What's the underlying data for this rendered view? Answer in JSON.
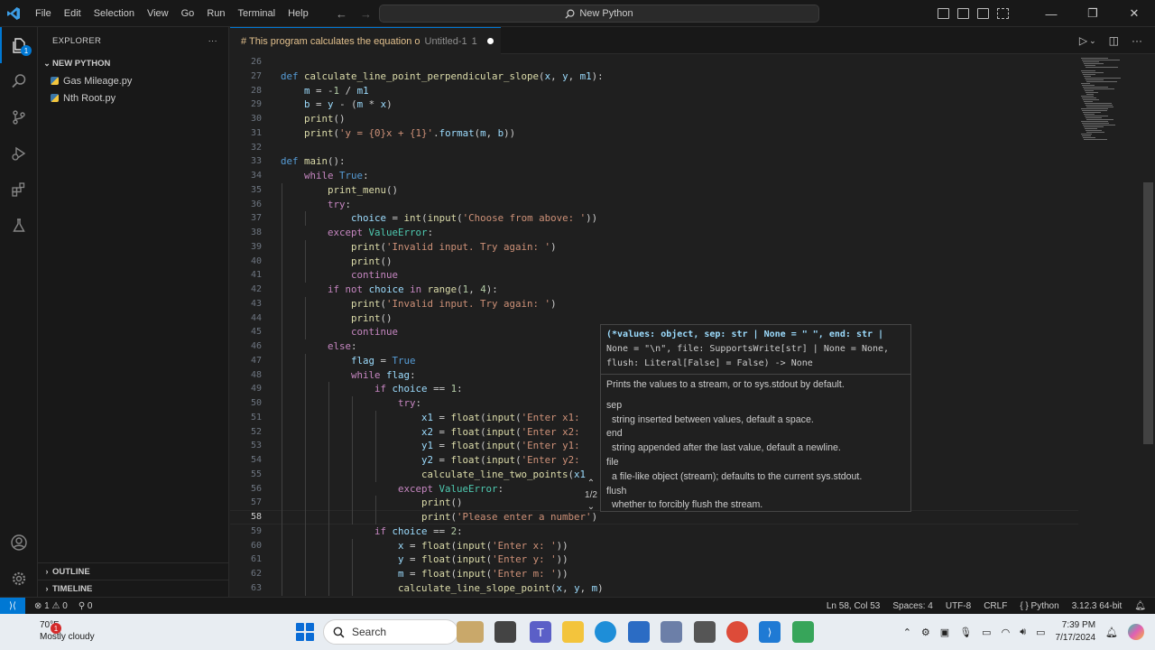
{
  "titlebar": {
    "menu": [
      "File",
      "Edit",
      "Selection",
      "View",
      "Go",
      "Run",
      "Terminal",
      "Help"
    ],
    "search_text": "New Python",
    "back_arrow": "←",
    "forward_arrow": "→"
  },
  "activity": {
    "explorer_badge": "1"
  },
  "sidebar": {
    "header": "EXPLORER",
    "more": "···",
    "folder": "NEW PYTHON",
    "files": [
      "Gas Mileage.py",
      "Nth Root.py"
    ],
    "outline": "OUTLINE",
    "timeline": "TIMELINE"
  },
  "tab": {
    "title": "# This program calculates the equation o",
    "file": "Untitled-1",
    "number": "1"
  },
  "editor": {
    "current_line": 58,
    "lines": [
      {
        "n": "26",
        "t": ""
      },
      {
        "n": "27",
        "t": "def calculate_line_point_perpendicular_slope(x, y, m1):"
      },
      {
        "n": "28",
        "t": "    m = -1 / m1"
      },
      {
        "n": "29",
        "t": "    b = y - (m * x)"
      },
      {
        "n": "30",
        "t": "    print()"
      },
      {
        "n": "31",
        "t": "    print('y = {0}x + {1}'.format(m, b))"
      },
      {
        "n": "32",
        "t": ""
      },
      {
        "n": "33",
        "t": "def main():"
      },
      {
        "n": "34",
        "t": "    while True:"
      },
      {
        "n": "35",
        "t": "        print_menu()"
      },
      {
        "n": "36",
        "t": "        try:"
      },
      {
        "n": "37",
        "t": "            choice = int(input('Choose from above: '))"
      },
      {
        "n": "38",
        "t": "        except ValueError:"
      },
      {
        "n": "39",
        "t": "            print('Invalid input. Try again: ')"
      },
      {
        "n": "40",
        "t": "            print()"
      },
      {
        "n": "41",
        "t": "            continue"
      },
      {
        "n": "42",
        "t": "        if not choice in range(1, 4):"
      },
      {
        "n": "43",
        "t": "            print('Invalid input. Try again: ')"
      },
      {
        "n": "44",
        "t": "            print()"
      },
      {
        "n": "45",
        "t": "            continue"
      },
      {
        "n": "46",
        "t": "        else:"
      },
      {
        "n": "47",
        "t": "            flag = True"
      },
      {
        "n": "48",
        "t": "            while flag:"
      },
      {
        "n": "49",
        "t": "                if choice == 1:"
      },
      {
        "n": "50",
        "t": "                    try:"
      },
      {
        "n": "51",
        "t": "                        x1 = float(input('Enter x1:"
      },
      {
        "n": "52",
        "t": "                        x2 = float(input('Enter x2:"
      },
      {
        "n": "53",
        "t": "                        y1 = float(input('Enter y1:"
      },
      {
        "n": "54",
        "t": "                        y2 = float(input('Enter y2:"
      },
      {
        "n": "55",
        "t": "                        calculate_line_two_points(x1"
      },
      {
        "n": "56",
        "t": "                    except ValueError:"
      },
      {
        "n": "57",
        "t": "                        print()"
      },
      {
        "n": "58",
        "t": "                        print('Please enter a number')"
      },
      {
        "n": "59",
        "t": "                if choice == 2:"
      },
      {
        "n": "60",
        "t": "                    x = float(input('Enter x: '))"
      },
      {
        "n": "61",
        "t": "                    y = float(input('Enter y: '))"
      },
      {
        "n": "62",
        "t": "                    m = float(input('Enter m: '))"
      },
      {
        "n": "63",
        "t": "                    calculate_line_slope_point(x, y, m)"
      }
    ]
  },
  "hover": {
    "signature_lines": [
      "(*values: object, sep: str | None = \" \", end: str |",
      "None = \"\\n\", file: SupportsWrite[str] | None = None,",
      "flush: Literal[False] = False) -> None"
    ],
    "summary": "Prints the values to a stream, or to sys.stdout by default.",
    "params": [
      {
        "name": "sep",
        "desc": "string inserted between values, default a space."
      },
      {
        "name": "end",
        "desc": "string appended after the last value, default a newline."
      },
      {
        "name": "file",
        "desc": "a file-like object (stream); defaults to the current sys.stdout."
      },
      {
        "name": "flush",
        "desc": "whether to forcibly flush the stream."
      }
    ],
    "overload": "1/2"
  },
  "statusbar": {
    "errors": "⊗ 1 ⚠ 0",
    "ports": "⚲ 0",
    "position": "Ln 58, Col 53",
    "spaces": "Spaces: 4",
    "encoding": "UTF-8",
    "eol": "CRLF",
    "language": "{ } Python",
    "interpreter": "3.12.3 64-bit"
  },
  "taskbar": {
    "weather_temp": "70°F",
    "weather_desc": "Mostly cloudy",
    "weather_badge": "1",
    "search_placeholder": "Search",
    "time": "7:39 PM",
    "date": "7/17/2024"
  },
  "colors": {
    "accent": "#0078d4",
    "editor_bg": "#1f1f1f",
    "chrome_bg": "#181818",
    "modified_tab": "#e2c08d"
  }
}
